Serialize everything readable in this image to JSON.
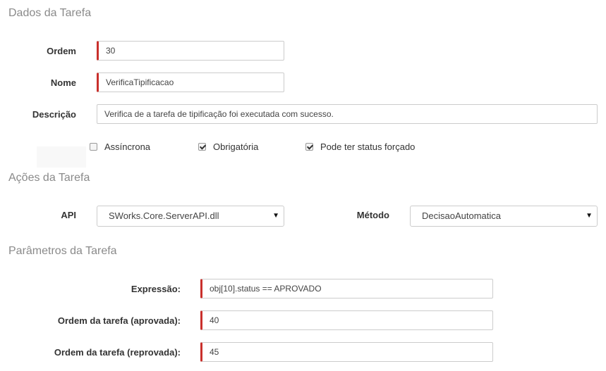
{
  "sections": {
    "dados": "Dados da Tarefa",
    "acoes": "Ações da Tarefa",
    "parametros": "Parâmetros da Tarefa"
  },
  "dados": {
    "ordem_label": "Ordem",
    "ordem_value": "30",
    "nome_label": "Nome",
    "nome_value": "VerificaTipificacao",
    "descricao_label": "Descrição",
    "descricao_value": "Verifica de a tarefa de tipificação foi executada com sucesso.",
    "assincrona_label": "Assíncrona",
    "assincrona_checked": false,
    "obrigatoria_label": "Obrigatória",
    "obrigatoria_checked": true,
    "status_forcado_label": "Pode ter status forçado",
    "status_forcado_checked": true
  },
  "acoes": {
    "api_label": "API",
    "api_value": "SWorks.Core.ServerAPI.dll",
    "metodo_label": "Método",
    "metodo_value": "DecisaoAutomatica",
    "caret": "▼"
  },
  "parametros": {
    "expressao_label": "Expressão:",
    "expressao_value": "obj[10].status == APROVADO",
    "aprovada_label": "Ordem da tarefa (aprovada):",
    "aprovada_value": "40",
    "reprovada_label": "Ordem da tarefa (reprovada):",
    "reprovada_value": "45"
  },
  "colors": {
    "required_marker": "#c9302c",
    "section_title": "#8a8a8a"
  }
}
